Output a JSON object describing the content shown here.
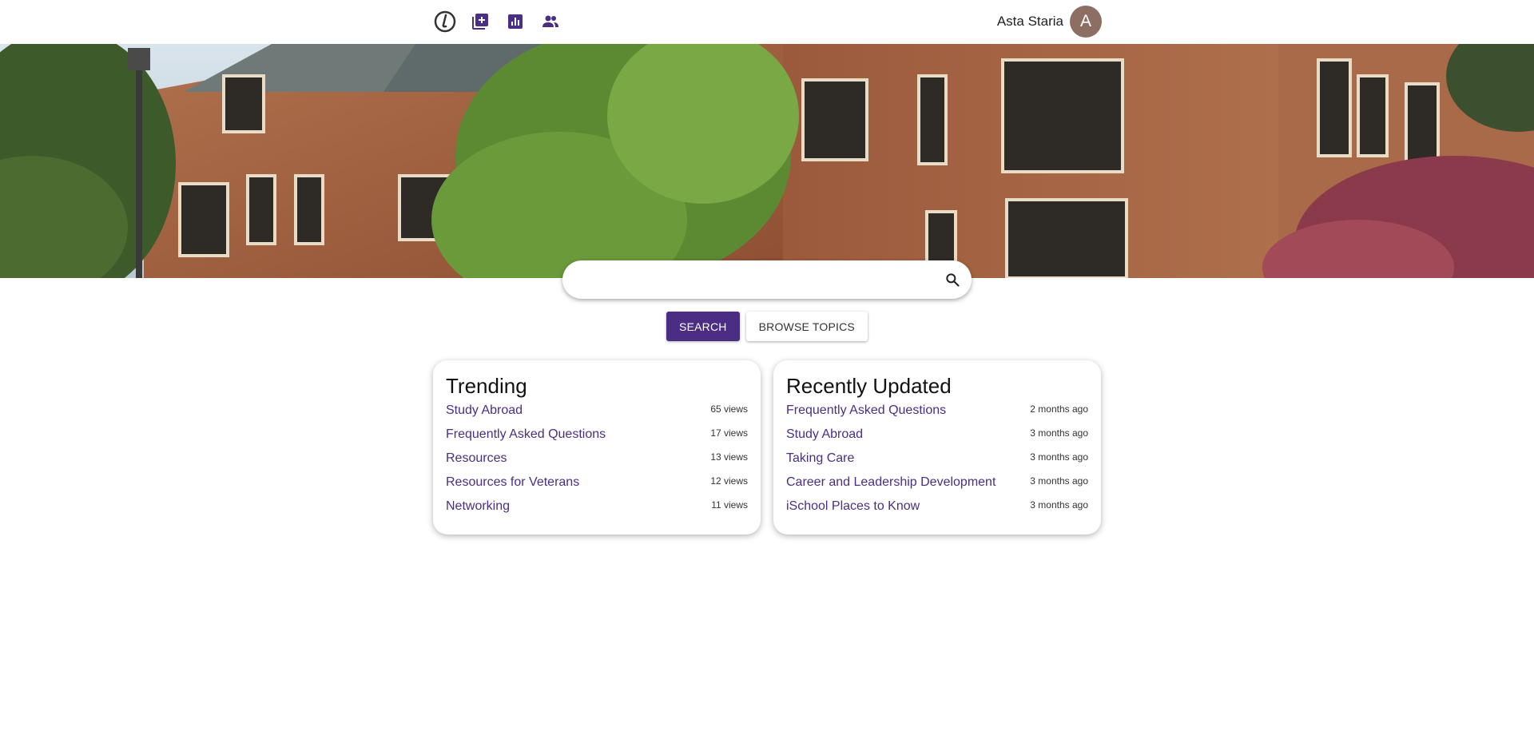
{
  "nav": {
    "icons": [
      "logo-icon",
      "add-page-icon",
      "analytics-icon",
      "people-icon"
    ],
    "accent_color": "#4b2e83"
  },
  "user": {
    "name": "Asta Staria",
    "avatar_initial": "A",
    "avatar_color": "#8d6e63"
  },
  "search": {
    "placeholder": "",
    "value": "",
    "search_button": "SEARCH",
    "browse_button": "BROWSE TOPICS"
  },
  "trending": {
    "title": "Trending",
    "items": [
      {
        "label": "Study Abroad",
        "meta": "65 views"
      },
      {
        "label": "Frequently Asked Questions",
        "meta": "17 views"
      },
      {
        "label": "Resources",
        "meta": "13 views"
      },
      {
        "label": "Resources for Veterans",
        "meta": "12 views"
      },
      {
        "label": "Networking",
        "meta": "11 views"
      }
    ]
  },
  "recent": {
    "title": "Recently Updated",
    "items": [
      {
        "label": "Frequently Asked Questions",
        "meta": "2 months ago"
      },
      {
        "label": "Study Abroad",
        "meta": "3 months ago"
      },
      {
        "label": "Taking Care",
        "meta": "3 months ago"
      },
      {
        "label": "Career and Leadership Development",
        "meta": "3 months ago"
      },
      {
        "label": "iSchool Places to Know",
        "meta": "3 months ago"
      }
    ]
  }
}
